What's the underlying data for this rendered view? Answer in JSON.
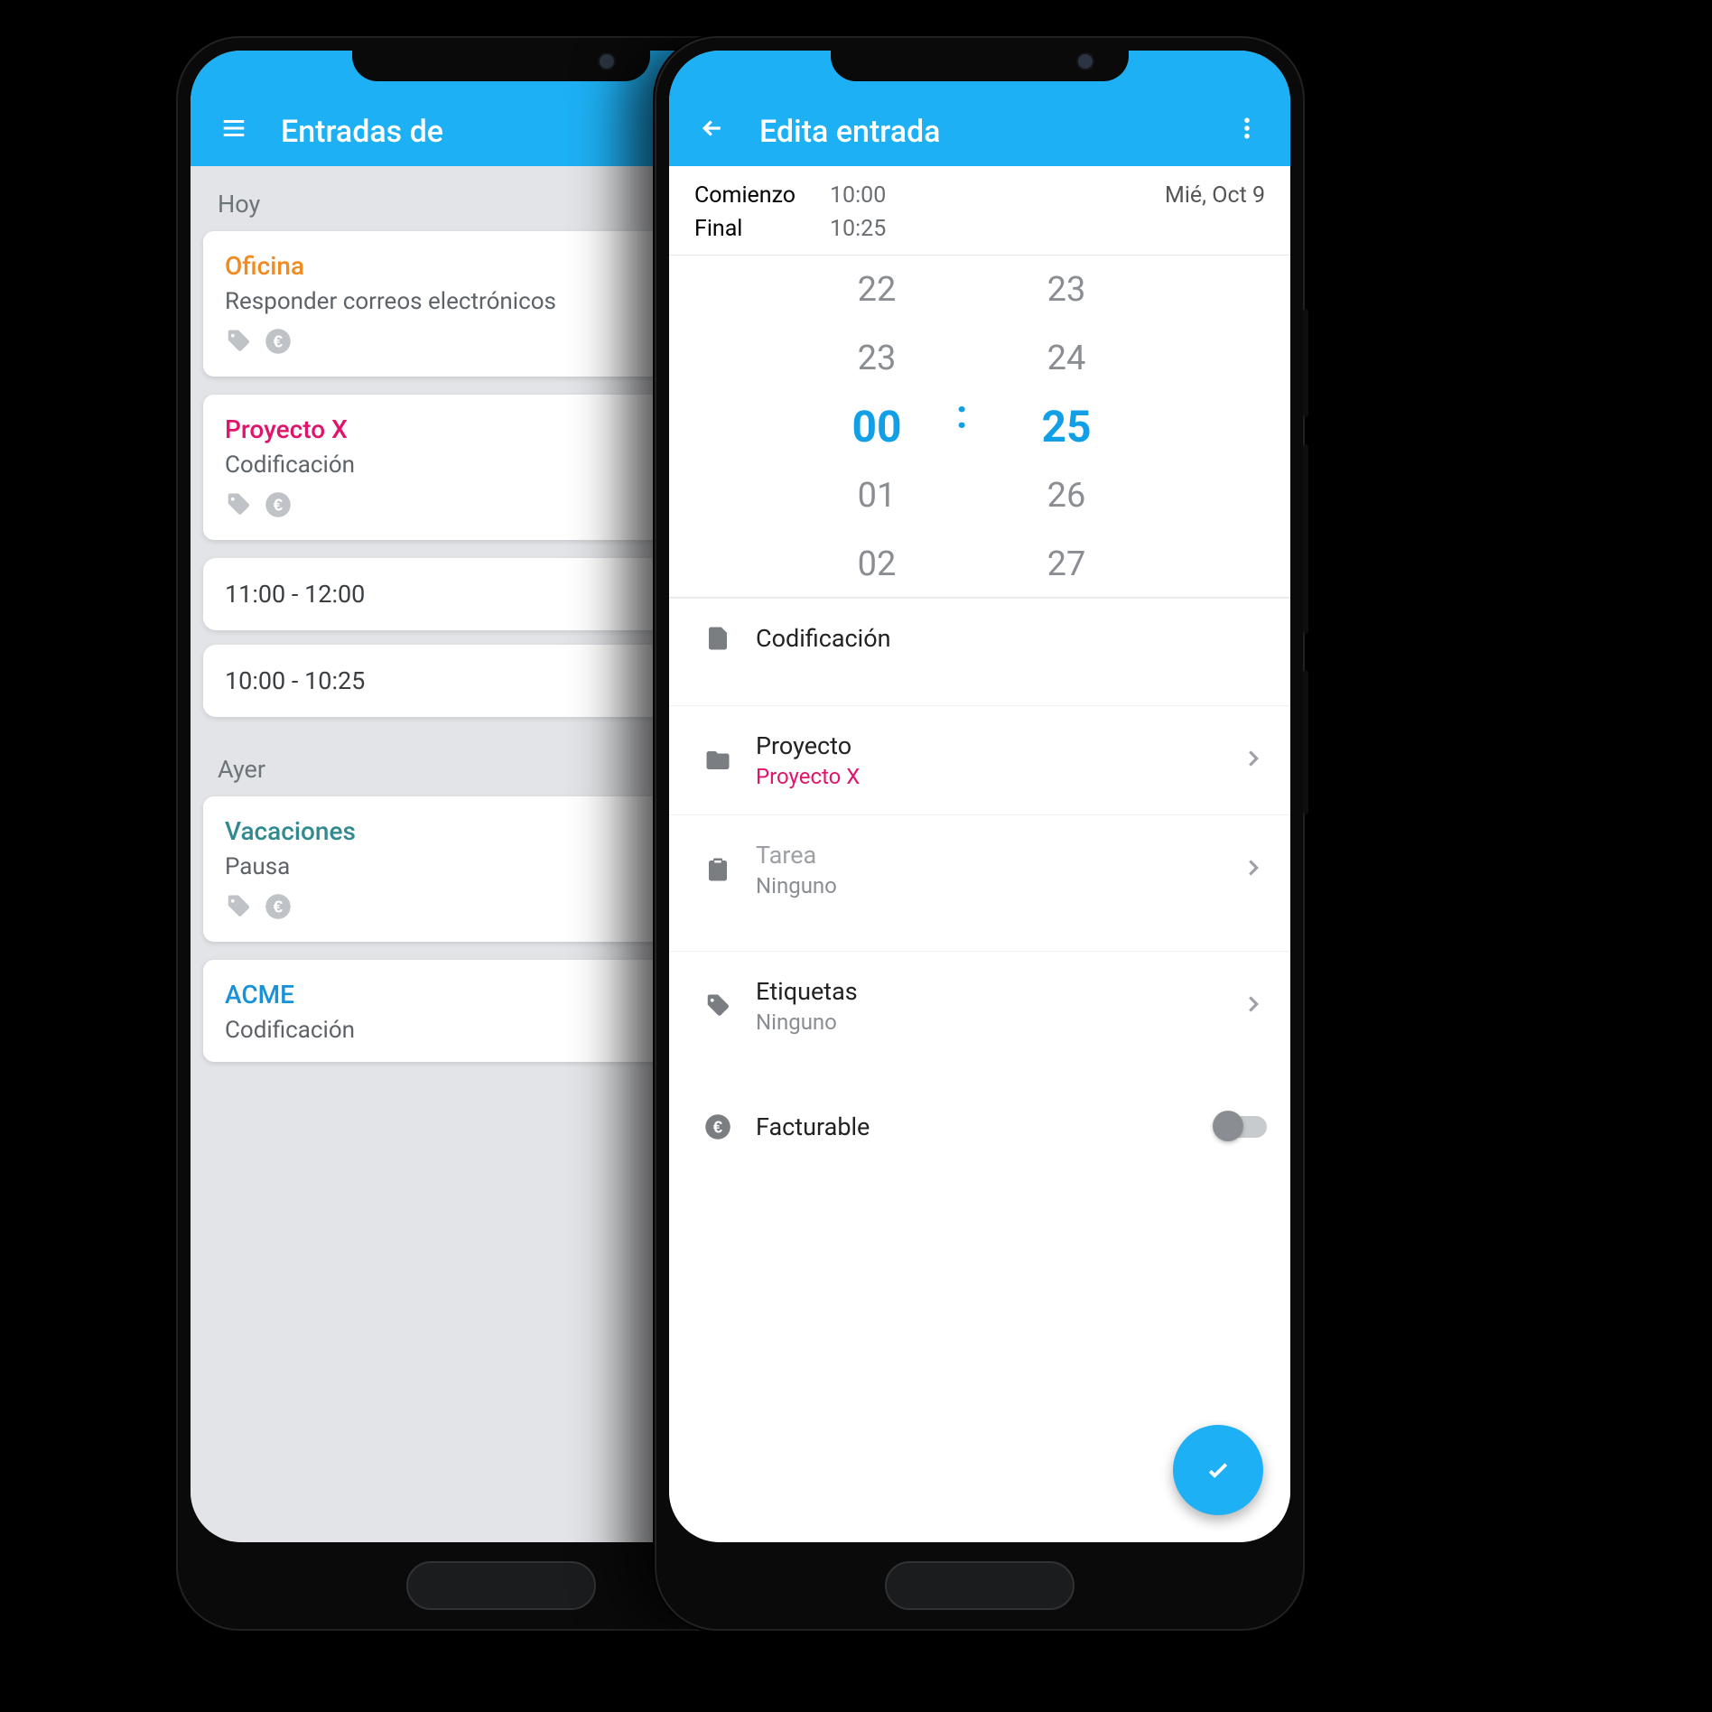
{
  "left": {
    "appbar_title": "Entradas de",
    "section_today": "Hoy",
    "section_yesterday": "Ayer",
    "entries": [
      {
        "project": "Oficina",
        "color": "c-orange",
        "desc": "Responder correos electrónicos"
      },
      {
        "project": "Proyecto X",
        "color": "c-pink",
        "desc": "Codificación"
      }
    ],
    "slots": [
      "11:00 - 12:00",
      "10:00 - 10:25"
    ],
    "yesterday": [
      {
        "project": "Vacaciones",
        "color": "c-teal",
        "desc": "Pausa"
      },
      {
        "project": "ACME",
        "color": "c-blue",
        "desc": "Codificación"
      }
    ]
  },
  "right": {
    "appbar_title": "Edita entrada",
    "start_label": "Comienzo",
    "start_time": "10:00",
    "end_label": "Final",
    "end_time": "10:25",
    "date": "Mié, Oct 9",
    "wheel": {
      "hours": [
        "22",
        "23",
        "00",
        "01",
        "02"
      ],
      "mins": [
        "23",
        "24",
        "25",
        "26",
        "27"
      ]
    },
    "desc": "Codificación",
    "project_label": "Proyecto",
    "project_value": "Proyecto X",
    "task_label": "Tarea",
    "task_value": "Ninguno",
    "tags_label": "Etiquetas",
    "tags_value": "Ninguno",
    "billable_label": "Facturable"
  }
}
